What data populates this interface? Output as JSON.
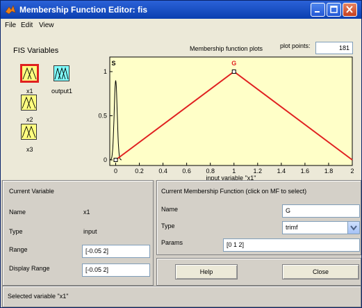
{
  "window": {
    "title": "Membership Function Editor: fis"
  },
  "menu": {
    "items": [
      "File",
      "Edit",
      "View"
    ]
  },
  "fis_variables": {
    "heading": "FIS Variables",
    "inputs": [
      {
        "label": "x1"
      },
      {
        "label": "x2"
      },
      {
        "label": "x3"
      }
    ],
    "outputs": [
      {
        "label": "output1"
      }
    ]
  },
  "plot": {
    "heading": "Membership function plots",
    "points_label": "plot points:",
    "points_value": "181",
    "mf_labels": [
      "S",
      "G"
    ],
    "y_ticks": [
      "0",
      "0.5",
      "1"
    ],
    "x_ticks": [
      "0",
      "0.2",
      "0.4",
      "0.6",
      "0.8",
      "1",
      "1.2",
      "1.4",
      "1.6",
      "1.8",
      "2"
    ],
    "xlabel": "input variable \"x1\""
  },
  "current_variable": {
    "title": "Current Variable",
    "name_label": "Name",
    "name_value": "x1",
    "type_label": "Type",
    "type_value": "input",
    "range_label": "Range",
    "range_value": "[-0.05 2]",
    "display_range_label": "Display Range",
    "display_range_value": "[-0.05 2]"
  },
  "current_mf": {
    "title": "Current Membership Function (click on MF to select)",
    "name_label": "Name",
    "name_value": "G",
    "type_label": "Type",
    "type_value": "trimf",
    "params_label": "Params",
    "params_value": "[0 1 2]"
  },
  "buttons": {
    "help": "Help",
    "close": "Close"
  },
  "status": "Selected variable \"x1\"",
  "chart_data": {
    "type": "line",
    "xlabel": "input variable \"x1\"",
    "xlim": [
      -0.05,
      2
    ],
    "ylim": [
      0,
      1
    ],
    "series": [
      {
        "name": "S",
        "x": [
          -0.05,
          0.0,
          0.05
        ],
        "y": [
          0,
          0.9,
          0
        ],
        "color": "#000000"
      },
      {
        "name": "G",
        "x": [
          0,
          1,
          2
        ],
        "y": [
          0,
          1,
          0
        ],
        "color": "#e02020"
      }
    ]
  }
}
